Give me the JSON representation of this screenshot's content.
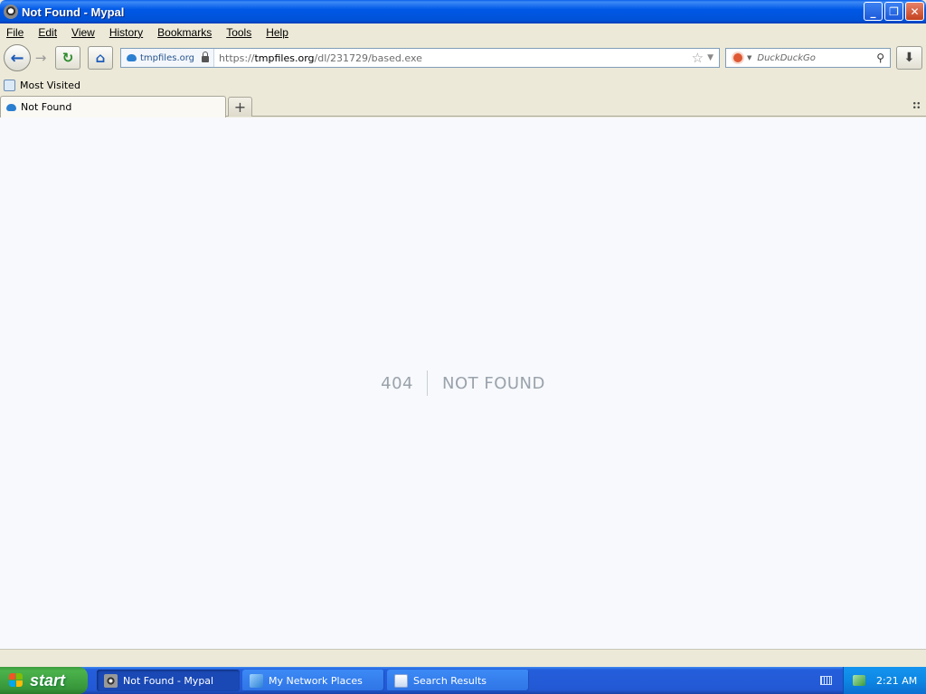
{
  "window": {
    "title": "Not Found - Mypal"
  },
  "menu": [
    "File",
    "Edit",
    "View",
    "History",
    "Bookmarks",
    "Tools",
    "Help"
  ],
  "urlbar": {
    "identity": "tmpfiles.org",
    "url_prefix": "https://",
    "url_host": "tmpfiles.org",
    "url_path": "/dl/231729/based.exe"
  },
  "search": {
    "placeholder": "DuckDuckGo"
  },
  "bookmarks": {
    "most_visited": "Most Visited"
  },
  "tabs": [
    {
      "label": "Not Found"
    }
  ],
  "page": {
    "code": "404",
    "message": "NOT FOUND"
  },
  "taskbar": {
    "start": "start",
    "items": [
      {
        "label": "Not Found - Mypal",
        "active": true
      },
      {
        "label": "My Network Places",
        "active": false
      },
      {
        "label": "Search Results",
        "active": false
      }
    ],
    "clock": "2:21 AM"
  },
  "colors": {
    "titlebar": "#0058e6",
    "page_background": "#f7f9fc",
    "error_text": "#9aa2ab",
    "start_green": "#3c9b3c",
    "taskbar_blue": "#245edb"
  }
}
